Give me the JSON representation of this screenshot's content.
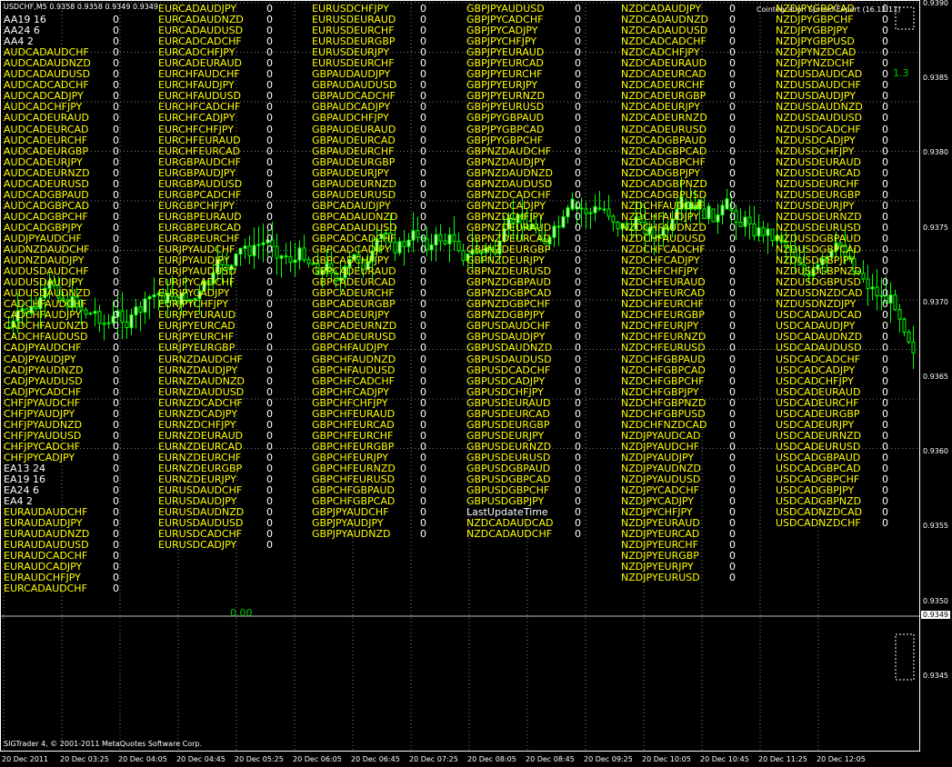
{
  "window": {
    "symbol_line": "USDCHF,M5  0.9358 0.9358 0.9349 0.9349",
    "indicator_label": "Cointegration Spread Expert (16.12.11)",
    "indicator_value": "1.3",
    "cell_value": "0",
    "zero_value": "0.00",
    "copyright": "SIGTrader 4, © 2001-2011 MetaQuotes Software Corp.",
    "current_price": "0.9349"
  },
  "colors": {
    "background": "#000000",
    "grid": "#808080",
    "text_yellow": "#ffff00",
    "text_white": "#ffffff",
    "candle_green": "#00ff00",
    "candle_body": "#ccffaa",
    "value_green": "#00c800"
  },
  "columns": [
    [
      "USDCHF,M5",
      "AA19 16",
      "AA24 6",
      "AA4 2",
      "AUDCADAUDCHF",
      "AUDCADAUDNZD",
      "AUDCADAUDUSD",
      "AUDCADCADCHF",
      "AUDCADCADJPY",
      "AUDCADCHFJPY",
      "AUDCADEURAUD",
      "AUDCADEURCAD",
      "AUDCADEURCHF",
      "AUDCADEURGBP",
      "AUDCADEURJPY",
      "AUDCADEURNZD",
      "AUDCADEURUSD",
      "AUDCADGBPAUD",
      "AUDCADGBPCAD",
      "AUDCADGBPCHF",
      "AUDCADGBPJPY",
      "AUDJPYAUDCHF",
      "AUDNZDAUDCHF",
      "AUDNZDAUDJPY",
      "AUDUSDAUDCHF",
      "AUDUSDAUDJPY",
      "AUDUSDAUDNZD",
      "CADCHFAUDCHF",
      "CADCHFAUDJPY",
      "CADCHFAUDNZD",
      "CADCHFAUDUSD",
      "CADJPYAUDCHF",
      "CADJPYAUDJPY",
      "CADJPYAUDNZD",
      "CADJPYAUDUSD",
      "CADJPYCADCHF",
      "CHFJPYAUDCHF",
      "CHFJPYAUDJPY",
      "CHFJPYAUDNZD",
      "CHFJPYAUDUSD",
      "CHFJPYCADCHF",
      "CHFJPYCADJPY",
      "EA13 24",
      "EA19 16",
      "EA24 6",
      "EA4 2",
      "EURAUDAUDCHF",
      "EURAUDAUDJPY",
      "EURAUDAUDNZD",
      "EURAUDAUDUSD",
      "EURAUDCADCHF",
      "EURAUDCADJPY",
      "EURAUDCHFJPY",
      "EURCADAUDCHF"
    ],
    [
      "EURCADAUDJPY",
      "EURCADAUDNZD",
      "EURCADAUDUSD",
      "EURCADCADCHF",
      "EURCADCHFJPY",
      "EURCADEURAUD",
      "EURCHFAUDCHF",
      "EURCHFAUDJPY",
      "EURCHFAUDUSD",
      "EURCHFCADCHF",
      "EURCHFCADJPY",
      "EURCHFCHFJPY",
      "EURCHFEURAUD",
      "EURCHFEURCAD",
      "EURGBPAUDCHF",
      "EURGBPAUDJPY",
      "EURGBPAUDUSD",
      "EURGBPCADCHF",
      "EURGBPCHFJPY",
      "EURGBPEURAUD",
      "EURGBPEURCAD",
      "EURGBPEURCHF",
      "EURJPYAUDCHF",
      "EURJPYAUDJPY",
      "EURJPYAUDUSD",
      "EURJPYCADCHF",
      "EURJPYCADJPY",
      "EURJPYCHFJPY",
      "EURJPYEURAUD",
      "EURJPYEURCAD",
      "EURJPYEURCHF",
      "EURJPYEURGBP",
      "EURNZDAUDCHF",
      "EURNZDAUDJPY",
      "EURNZDAUDNZD",
      "EURNZDAUDUSD",
      "EURNZDCADCHF",
      "EURNZDCADJPY",
      "EURNZDCHFJPY",
      "EURNZDEURAUD",
      "EURNZDEURCAD",
      "EURNZDEURCHF",
      "EURNZDEURGBP",
      "EURNZDEURJPY",
      "EURUSDAUDCHF",
      "EURUSDAUDJPY",
      "EURUSDAUDNZD",
      "EURUSDAUDUSD",
      "EURUSDCADCHF",
      "EURUSDCADJPY"
    ],
    [
      "EURUSDCHFJPY",
      "EURUSDEURAUD",
      "EURUSDEURCHF",
      "EURUSDEURGBP",
      "EURUSDEURJPY",
      "EURUSDEURCHF",
      "GBPAUDAUDJPY",
      "GBPAUDAUDUSD",
      "GBPAUDCADCHF",
      "GBPAUDCADJPY",
      "GBPAUDCHFJPY",
      "GBPAUDEURAUD",
      "GBPAUDEURCAD",
      "GBPAUDEURCHF",
      "GBPAUDEURGBP",
      "GBPAUDEURJPY",
      "GBPAUDEURNZD",
      "GBPAUDEURUSD",
      "GBPCADAUDJPY",
      "GBPCADAUDNZD",
      "GBPCADAUDUSD",
      "GBPCADCADCHF",
      "GBPCADCADJPY",
      "GBPCADCHFJPY",
      "GBPCADEURAUD",
      "GBPCADEURCAD",
      "GBPCADEURCHF",
      "GBPCADEURGBP",
      "GBPCADEURJPY",
      "GBPCADEURNZD",
      "GBPCADEURUSD",
      "GBPCHFAUDJPY",
      "GBPCHFAUDNZD",
      "GBPCHFAUDUSD",
      "GBPCHFCADCHF",
      "GBPCHFCADJPY",
      "GBPCHFCHFJPY",
      "GBPCHFEURAUD",
      "GBPCHFEURCAD",
      "GBPCHFEURCHF",
      "GBPCHFEURGBP",
      "GBPCHFEURJPY",
      "GBPCHFEURNZD",
      "GBPCHFEURUSD",
      "GBPCHFGBPAUD",
      "GBPCHFGBPCAD",
      "GBPJPYAUDCHF",
      "GBPJPYAUDJPY",
      "GBPJPYAUDNZD"
    ],
    [
      "GBPJPYAUDUSD",
      "GBPJPYCADCHF",
      "GBPJPYCADJPY",
      "GBPJPYCHFJPY",
      "GBPJPYEURAUD",
      "GBPJPYEURCAD",
      "GBPJPYEURCHF",
      "GBPJPYEURJPY",
      "GBPJPYEURNZD",
      "GBPJPYEURUSD",
      "GBPJPYGBPAUD",
      "GBPJPYGBPCAD",
      "GBPJPYGBPCHF",
      "GBPNZDAUDCHF",
      "GBPNZDAUDJPY",
      "GBPNZDAUDNZD",
      "GBPNZDAUDUSD",
      "GBPNZDCADCHF",
      "GBPNZDCADJPY",
      "GBPNZDCHFJPY",
      "GBPNZDEURAUD",
      "GBPNZDEURCAD",
      "GBPNZDEURGBP",
      "GBPNZDEURJPY",
      "GBPNZDEURUSD",
      "GBPNZDGBPAUD",
      "GBPNZDGBPCAD",
      "GBPNZDGBPCHF",
      "GBPNZDGBPJPY",
      "GBPUSDAUDCHF",
      "GBPUSDAUDJPY",
      "GBPUSDAUDNZD",
      "GBPUSDAUDUSD",
      "GBPUSDCADCHF",
      "GBPUSDCADJPY",
      "GBPUSDCHFJPY",
      "GBPUSDEURAUD",
      "GBPUSDEURCAD",
      "GBPUSDEURGBP",
      "GBPUSDEURJPY",
      "GBPUSDEURNZD",
      "GBPUSDEURUSD",
      "GBPUSDGBPAUD",
      "GBPUSDGBPCAD",
      "GBPUSDGBPCHF",
      "GBPUSDGBPJPY",
      "LastUpdateTime",
      "NZDCADAUDCAD",
      "NZDCADAUDCHF"
    ],
    [
      "NZDCADAUDJPY",
      "NZDCADAUDNZD",
      "NZDCADAUDUSD",
      "NZDCADCADCHF",
      "NZDCADCHFJPY",
      "NZDCADEURAUD",
      "NZDCADEURCAD",
      "NZDCADEURCHF",
      "NZDCADEURGBP",
      "NZDCADEURJPY",
      "NZDCADEURNZD",
      "NZDCADEURUSD",
      "NZDCADGBPAUD",
      "NZDCADGBPCAD",
      "NZDCADGBPCHF",
      "NZDCADGBPJPY",
      "NZDCADGBPNZD",
      "NZDCADGBPUSD",
      "NZDCHFAUDCHF",
      "NZDCHFAUDJPY",
      "NZDCHFAUDNZD",
      "NZDCHFAUDUSD",
      "NZDCHFCADCHF",
      "NZDCHFCADJPY",
      "NZDCHFCHFJPY",
      "NZDCHFEURAUD",
      "NZDCHFEURCAD",
      "NZDCHFEURCHF",
      "NZDCHFEURGBP",
      "NZDCHFEURJPY",
      "NZDCHFEURNZD",
      "NZDCHFEURUSD",
      "NZDCHFGBPAUD",
      "NZDCHFGBPCAD",
      "NZDCHFGBPCHF",
      "NZDCHFGBPJPY",
      "NZDCHFGBPNZD",
      "NZDCHFGBPUSD",
      "NZDCHFNZDCAD",
      "NZDJPYAUDCAD",
      "NZDJPYAUDCHF",
      "NZDJPYAUDJPY",
      "NZDJPYAUDNZD",
      "NZDJPYAUDUSD",
      "NZDJPYCADCHF",
      "NZDJPYCADJPY",
      "NZDJPYCHFJPY",
      "NZDJPYEURAUD",
      "NZDJPYEURCAD",
      "NZDJPYEURCHF",
      "NZDJPYEURGBP",
      "NZDJPYEURJPY",
      "NZDJPYEURUSD"
    ],
    [
      "NZDJPYGBPCAD",
      "NZDJPYGBPCHF",
      "NZDJPYGBPJPY",
      "NZDJPYGBPUSD",
      "NZDJPYNZDCAD",
      "NZDJPYNZDCHF",
      "NZDUSDAUDCAD",
      "NZDUSDAUDCHF",
      "NZDUSDAUDJPY",
      "NZDUSDAUDNZD",
      "NZDUSDAUDUSD",
      "NZDUSDCADCHF",
      "NZDUSDCADJPY",
      "NZDUSDCHFJPY",
      "NZDUSDEURAUD",
      "NZDUSDEURCAD",
      "NZDUSDEURCHF",
      "NZDUSDEURGBP",
      "NZDUSDEURJPY",
      "NZDUSDEURNZD",
      "NZDUSDEURUSD",
      "NZDUSDGBPAUD",
      "NZDUSDGBPCAD",
      "NZDUSDGBPJPY",
      "NZDUSDGBPNZD",
      "NZDUSDGBPUSD",
      "NZDUSDNZDCAD",
      "NZDUSDNZDJPY",
      "USDCADAUDCAD",
      "USDCADAUDJPY",
      "USDCADAUDNZD",
      "USDCADAUDUSD",
      "USDCADCADCHF",
      "USDCADCADJPY",
      "USDCADCHFJPY",
      "USDCADEURAUD",
      "USDCADEURCHF",
      "USDCADEURGBP",
      "USDCADEURJPY",
      "USDCADEURNZD",
      "USDCADEURUSD",
      "USDCADGBPAUD",
      "USDCADGBPCAD",
      "USDCADGBPCHF",
      "USDCADGBPJPY",
      "USDCADGBPNZD",
      "USDCADNZDCAD",
      "USDCADNZDCHF"
    ]
  ],
  "price_axis": {
    "labels": [
      "0.9390",
      "0.9385",
      "0.9380",
      "0.9375",
      "0.9370",
      "0.9365",
      "0.9360",
      "0.9355",
      "0.9350",
      "0.9345"
    ]
  },
  "time_axis": {
    "labels": [
      "20 Dec 2011",
      "20 Dec 03:25",
      "20 Dec 04:05",
      "20 Dec 04:45",
      "20 Dec 05:25",
      "20 Dec 06:05",
      "20 Dec 06:45",
      "20 Dec 07:25",
      "20 Dec 08:05",
      "20 Dec 08:45",
      "20 Dec 09:25",
      "20 Dec 10:05",
      "20 Dec 10:45",
      "20 Dec 11:25",
      "20 Dec 12:05"
    ]
  }
}
